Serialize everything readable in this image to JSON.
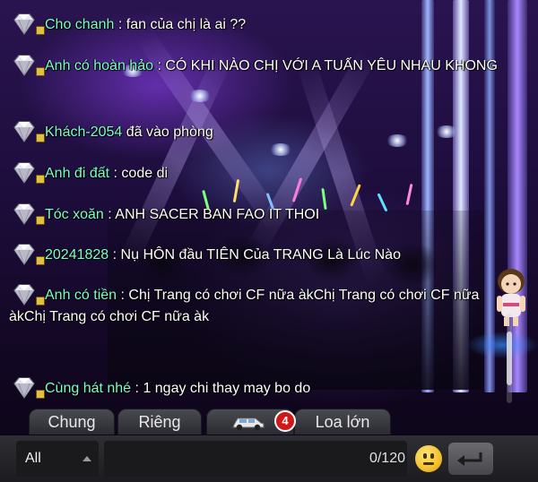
{
  "messages": [
    {
      "user": "Cho chanh",
      "text": "fan của chị là ai ??"
    },
    {
      "user": "Anh có hoàn hảo",
      "text": "CÓ KHI NÀO CHỊ VỚI A TUẤN YÊU NHAU KHONG"
    },
    {
      "user": "Khách-2054",
      "text": "đã vào phòng",
      "system": true
    },
    {
      "user": "Anh đi đất",
      "text": "code di"
    },
    {
      "user": "Tóc xoăn",
      "text": "ANH SACER BAN FAO IT THOI"
    },
    {
      "user": "20241828",
      "text": "Nụ HÔN đầu TIÊN Của TRANG Là Lúc Nào"
    },
    {
      "user": "Anh có tiền",
      "text": "Chị Trang có chơi CF nữa àkChị Trang có chơi CF nữa àkChị Trang có chơi CF nữa àk"
    },
    {
      "user": "Cùng hát nhé",
      "text": "1 ngay chi thay may bo do"
    }
  ],
  "separator": ":",
  "tabs": [
    {
      "label": "Chung"
    },
    {
      "label": "Riêng"
    },
    {
      "label": "",
      "icon": "car-icon",
      "badge": "4"
    },
    {
      "label": "Loa lớn"
    }
  ],
  "input": {
    "channel": "All",
    "value": "",
    "counter": "0/120"
  },
  "icons": {
    "message_badge": "diamond-icon",
    "emoji": "smiley-icon",
    "send": "enter-arrow-icon"
  },
  "colors": {
    "username": "#7dffc4",
    "message": "#ffffff",
    "badge": "#d01818"
  }
}
